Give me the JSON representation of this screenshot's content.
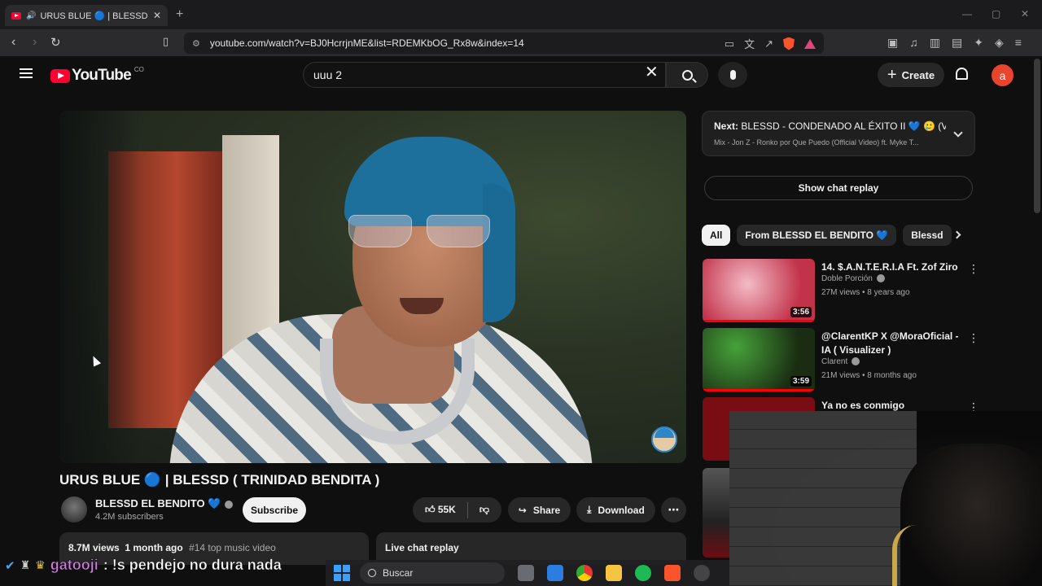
{
  "browser": {
    "tab_title": "URUS BLUE 🔵 | BLESSD ( TRI",
    "url": "youtube.com/watch?v=BJ0HcrrjnME&list=RDEMKbOG_Rx8w&index=14",
    "new_tab_label": "+"
  },
  "header": {
    "logo_text": "YouTube",
    "logo_region": "CO",
    "search_value": "uuu 2",
    "create_label": "Create",
    "avatar_letter": "a"
  },
  "video": {
    "title": "URUS BLUE 🔵 | BLESSD ( TRINIDAD BENDITA )",
    "channel_name": "BLESSD EL BENDITO 💙",
    "subscribers": "4.2M subscribers",
    "subscribe_label": "Subscribe",
    "likes": "55K",
    "share_label": "Share",
    "download_label": "Download",
    "views": "8.7M views",
    "age": "1 month ago",
    "tag": "#14 top music video",
    "live_chat_label": "Live chat replay"
  },
  "sidebar": {
    "next_prefix": "Next:",
    "next_title": "BLESSD - CONDENADO AL ÉXITO II 💙 🥲 (VI...",
    "next_subtitle": "Mix - Jon Z - Ronko por Que Puedo (Official Video) ft. Myke T...",
    "show_chat_label": "Show chat replay",
    "chips": [
      "All",
      "From BLESSD EL BENDITO 💙",
      "Blessd"
    ],
    "recommendations": [
      {
        "title": "14. $.A.N.T.E.R.I.A Ft.  Zof Ziro",
        "channel": "Doble Porción",
        "meta": "27M views • 8 years ago",
        "duration": "3:56",
        "progress": 1.0
      },
      {
        "title": "@ClarentKP X @MoraOficial - IA ( Visualizer )",
        "channel": "Clarent",
        "meta": "21M views • 8 months ago",
        "duration": "3:59",
        "progress": 1.0
      },
      {
        "title": "Ya no es conmigo",
        "channel": "",
        "meta": "",
        "duration": "",
        "progress": 0
      }
    ]
  },
  "chat_overlay": {
    "user": "gatooji",
    "message": ": !s pendejo no dura nada"
  },
  "taskbar": {
    "search_placeholder": "Buscar"
  },
  "colors": {
    "youtube_red": "#ff0033",
    "background": "#0f0f0f",
    "chip_active": "#f1f1f1",
    "chat_user": "#d27ee0"
  }
}
